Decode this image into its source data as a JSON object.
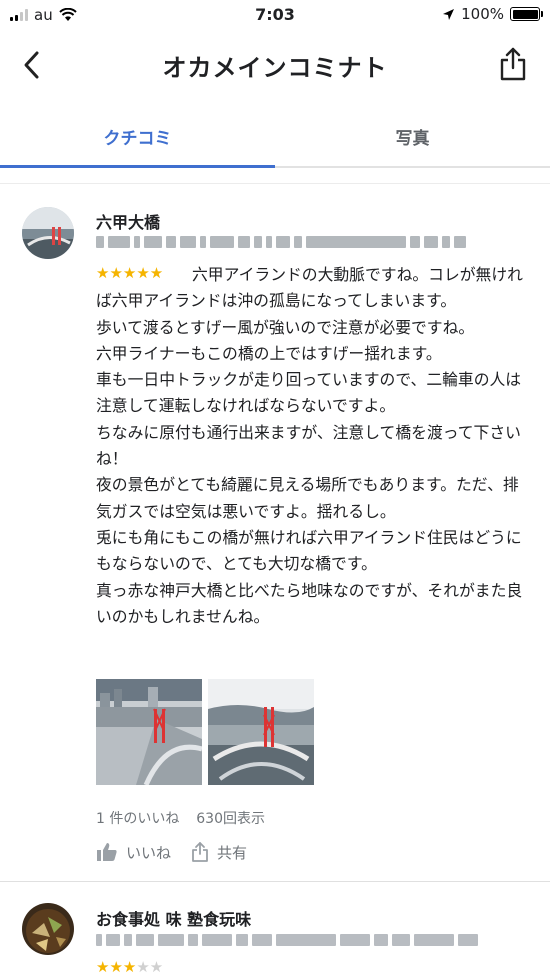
{
  "status_bar": {
    "carrier": "au",
    "time": "7:03",
    "battery": "100%"
  },
  "header": {
    "title": "オカメインコミナト",
    "back_icon": "chevron-left-icon",
    "share_icon": "share-icon"
  },
  "tabs": [
    {
      "label": "クチコミ",
      "active": true
    },
    {
      "label": "写真",
      "active": false
    }
  ],
  "reviews": [
    {
      "name": "六甲大橋",
      "rating": 5,
      "text_first": "六甲アイランドの大動脈ですね。コレが無ければ六甲アイランドは沖の孤島になってしまいます。",
      "text_lines": [
        "歩いて渡るとすげー風が強いので注意が必要ですね。",
        "六甲ライナーもこの橋の上ではすげー揺れます。",
        "車も一日中トラックが走り回っていますので、二輪車の人は注意して運転しなければならないですよ。",
        "ちなみに原付も通行出来ますが、注意して橋を渡って下さいね！",
        "夜の景色がとても綺麗に見える場所でもあります。ただ、排気ガスでは空気は悪いですよ。揺れるし。",
        "兎にも角にもこの橋が無ければ六甲アイランド住民はどうにもならないので、とても大切な橋です。",
        "真っ赤な神戸大橋と比べたら地味なのですが、それがまた良いのかもしれませんね。"
      ],
      "likes": "1 件のいいね",
      "views": "630回表示",
      "like_label": "いいね",
      "share_label": "共有"
    },
    {
      "name": "お食事処 味 塾食玩味",
      "rating": 3
    }
  ],
  "colors": {
    "accent": "#3f6fcf",
    "star": "#f5b400",
    "muted": "#70757a"
  }
}
